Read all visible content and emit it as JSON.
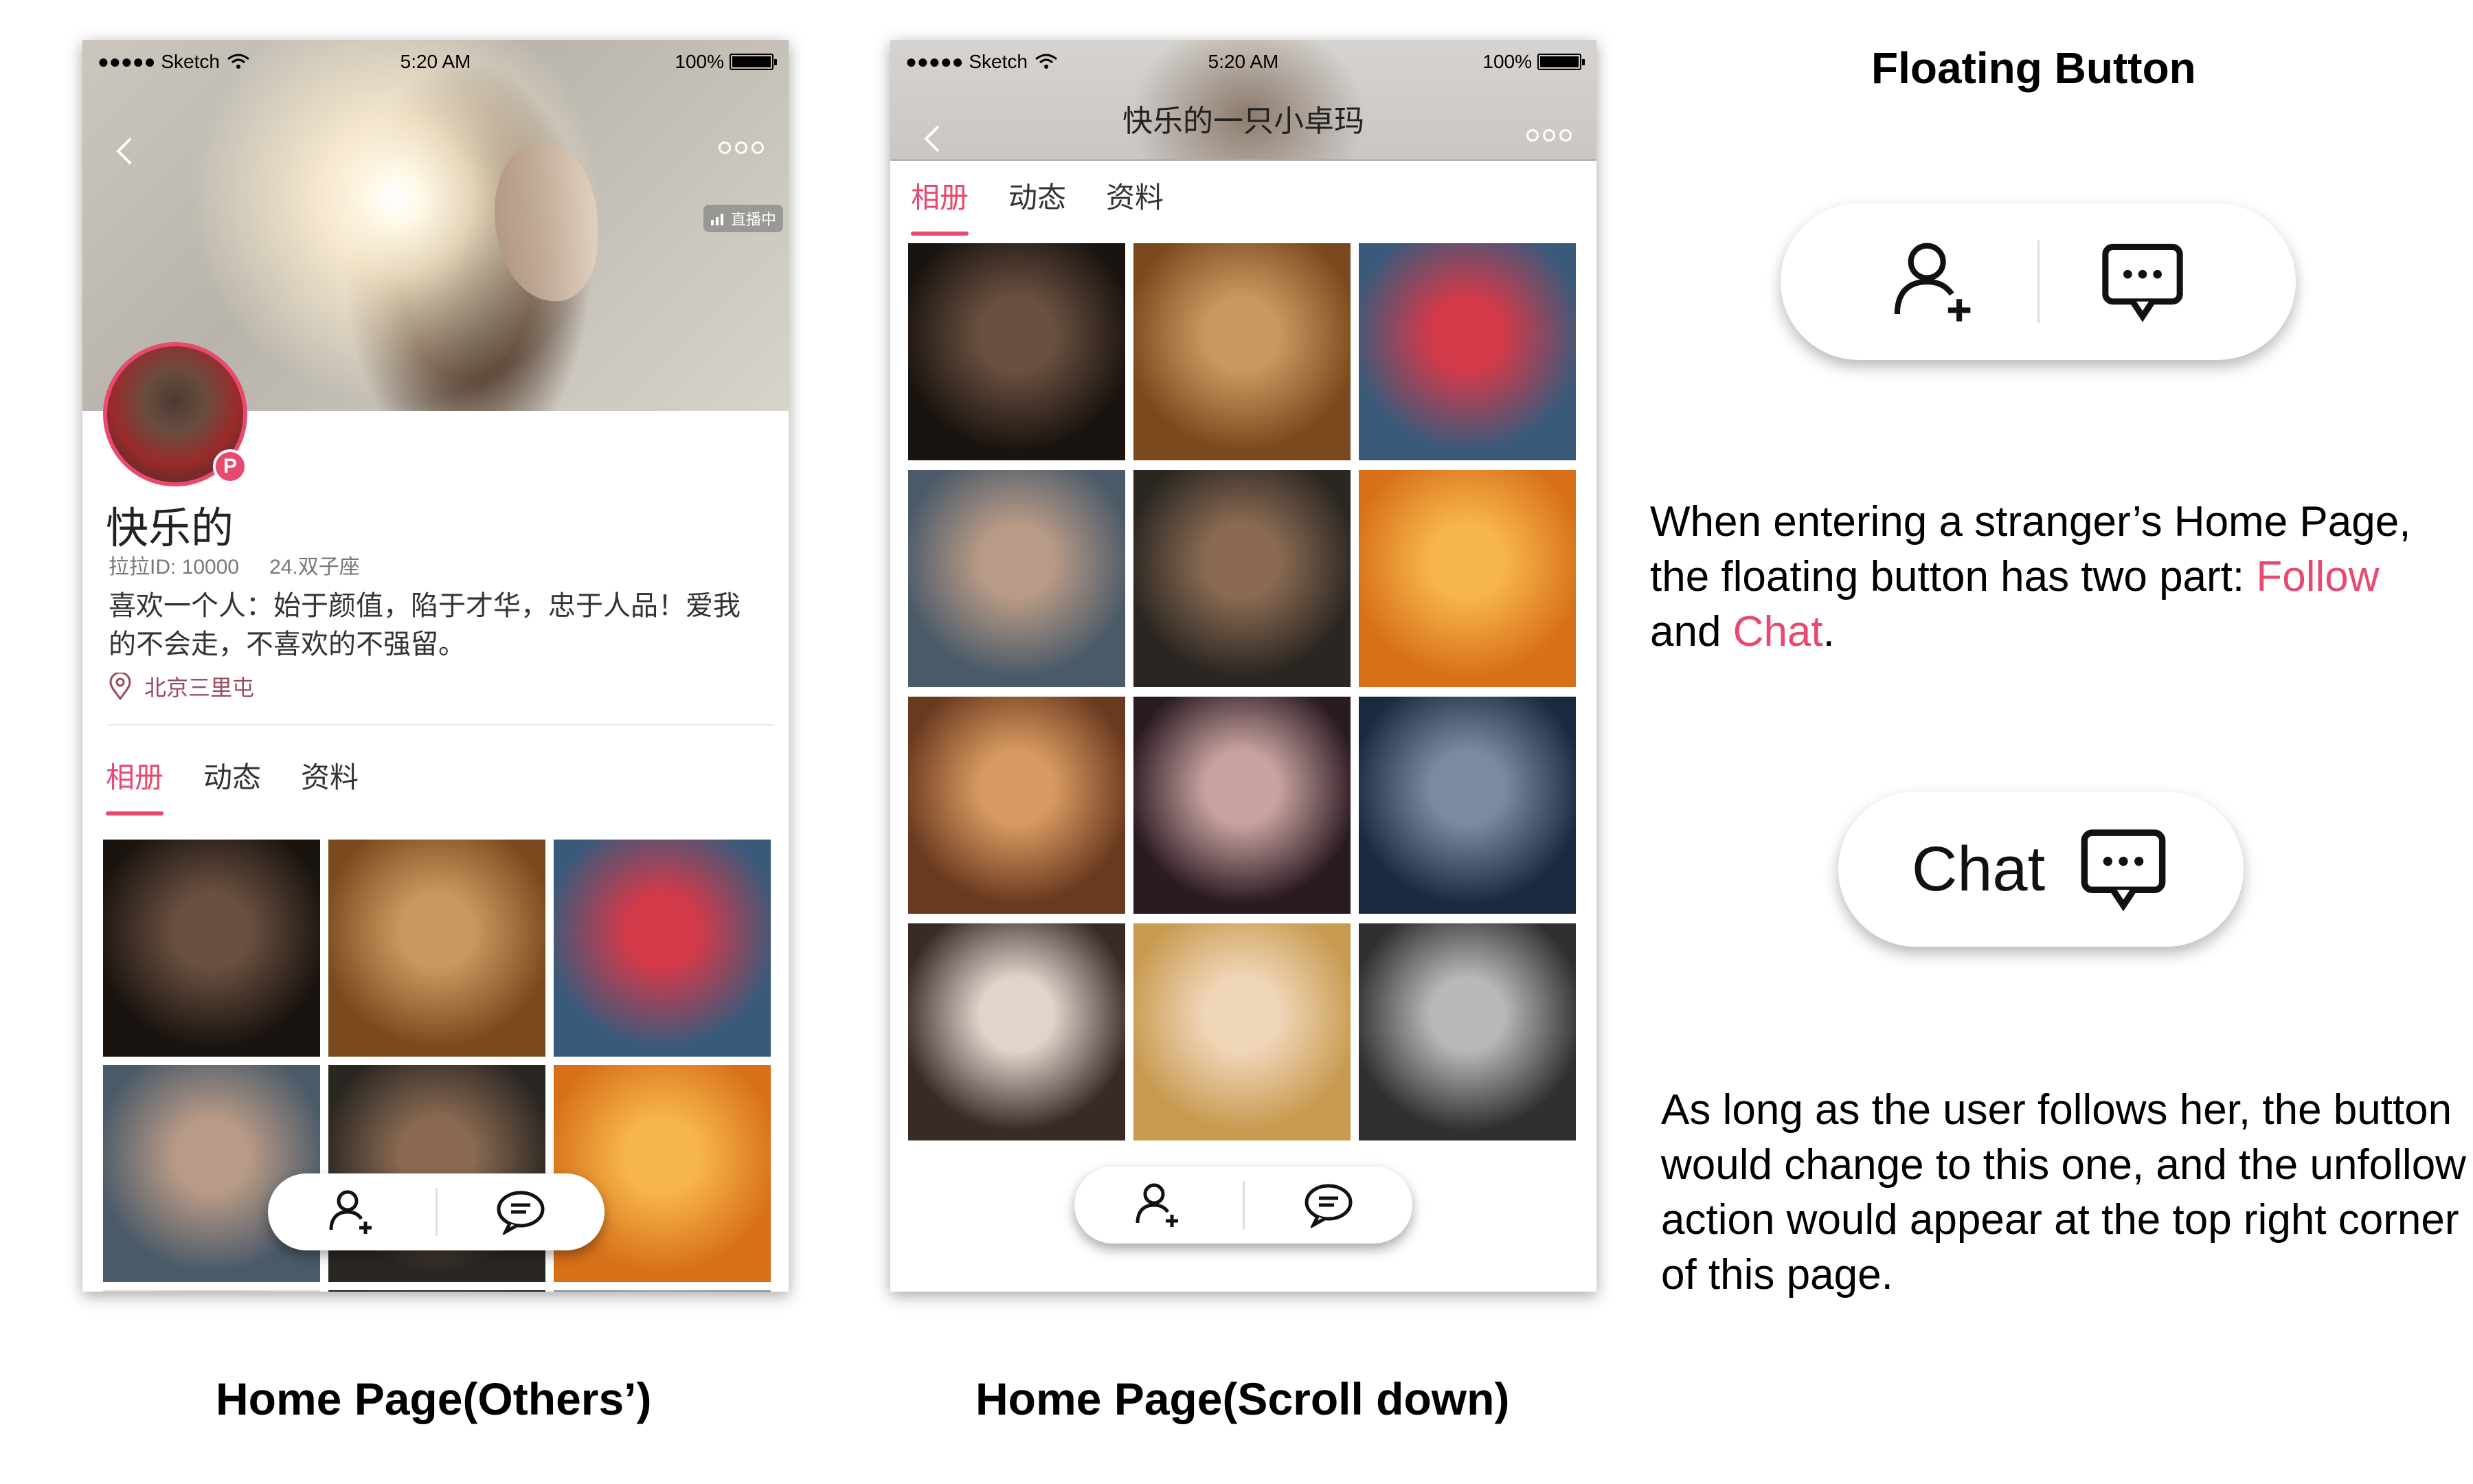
{
  "status_bar": {
    "carrier": "●●●●● Sketch",
    "time": "5:20 AM",
    "battery": "100%"
  },
  "profile": {
    "name": "快乐的",
    "lala_id": "拉拉ID: 10000",
    "age_sign": "24.双子座",
    "bio": "喜欢一个人：始于颜值，陷于才华，忠于人品！爱我的不会走，不喜欢的不强留。",
    "location": "北京三里屯",
    "live_badge": "直播中",
    "avatar_badge": "P"
  },
  "phone2": {
    "title": "快乐的一只小卓玛"
  },
  "tabs": [
    {
      "label": "相册"
    },
    {
      "label": "动态"
    },
    {
      "label": "资料"
    }
  ],
  "photos_phone1": [
    {
      "c1": "#1a1410",
      "c2": "#6a5040"
    },
    {
      "c1": "#7a4a1e",
      "c2": "#c99860"
    },
    {
      "c1": "#3a5a7a",
      "c2": "#d23a4a"
    },
    {
      "c1": "#4a5a68",
      "c2": "#b89a86"
    },
    {
      "c1": "#2a2622",
      "c2": "#8a6a52"
    },
    {
      "c1": "#d8701a",
      "c2": "#f7b64a"
    },
    {
      "c1": "#e8d8c8",
      "c2": "#c9b09a"
    },
    {
      "c1": "#201a1a",
      "c2": "#403434"
    },
    {
      "c1": "#8a8a90",
      "c2": "#b0b0b8"
    }
  ],
  "photos_phone2": [
    {
      "c1": "#1a1410",
      "c2": "#6a5040"
    },
    {
      "c1": "#7a4a1e",
      "c2": "#c99860"
    },
    {
      "c1": "#3a5a7a",
      "c2": "#d23a4a"
    },
    {
      "c1": "#4a5a68",
      "c2": "#b89a86"
    },
    {
      "c1": "#2a2622",
      "c2": "#8a6a52"
    },
    {
      "c1": "#d8701a",
      "c2": "#f7b64a"
    },
    {
      "c1": "#6a3a20",
      "c2": "#d89a60"
    },
    {
      "c1": "#2a1a22",
      "c2": "#c8a2a0"
    },
    {
      "c1": "#1a2a40",
      "c2": "#7a8aa0"
    },
    {
      "c1": "#3a2a26",
      "c2": "#e0d4cc"
    },
    {
      "c1": "#c89a50",
      "c2": "#f0d6b8"
    },
    {
      "c1": "#303030",
      "c2": "#b8b8b8"
    }
  ],
  "panel": {
    "title": "Floating Button",
    "desc_part1": "When entering a stranger’s Home Page, the floating button has two part: ",
    "follow": "Follow",
    "and": " and ",
    "chat": "Chat",
    "period": ".",
    "chat_button_label": "Chat",
    "desc2": "As long as the user follows her, the button would change to this one, and the unfollow action would appear at the top right corner of this page."
  },
  "captions": {
    "left": "Home Page(Others’)",
    "middle": "Home Page(Scroll down)"
  },
  "colors": {
    "accent": "#e9486f"
  }
}
